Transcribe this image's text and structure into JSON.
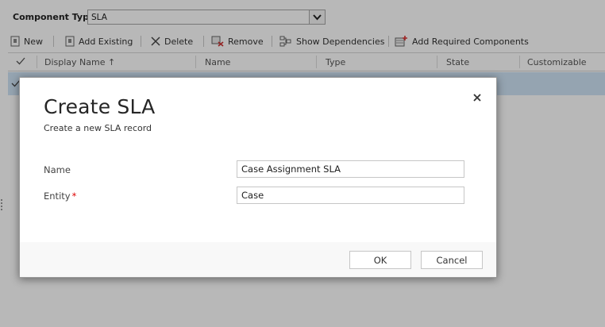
{
  "component_type": {
    "label": "Component Type",
    "selected": "SLA"
  },
  "toolbar": {
    "new": "New",
    "add_existing": "Add Existing",
    "delete": "Delete",
    "remove": "Remove",
    "show_dependencies": "Show Dependencies",
    "add_required": "Add Required Components"
  },
  "grid": {
    "columns": [
      "Display Name ↑",
      "Name",
      "Type",
      "State",
      "Customizable"
    ]
  },
  "dialog": {
    "title": "Create SLA",
    "subtitle": "Create a new SLA record",
    "fields": {
      "name_label": "Name",
      "name_value": "Case Assignment SLA",
      "entity_label": "Entity",
      "entity_required": "*",
      "entity_value": "Case"
    },
    "ok": "OK",
    "cancel": "Cancel"
  }
}
